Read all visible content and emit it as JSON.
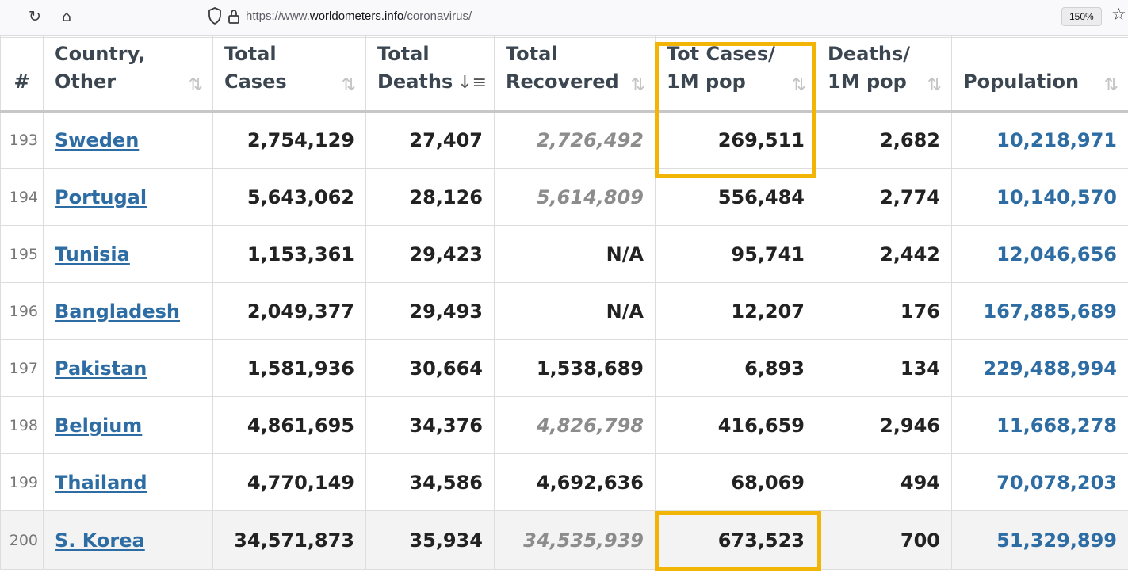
{
  "browser": {
    "url_prefix": "https://www.",
    "url_domain": "worldometers.info",
    "url_path": "/coronavirus/",
    "zoom": "150%",
    "icons": {
      "reload": "reload-icon",
      "home": "home-icon",
      "shield": "shield-icon",
      "lock": "lock-icon",
      "star": "star-icon"
    }
  },
  "table": {
    "columns": [
      {
        "label": "#"
      },
      {
        "label": "Country,\nOther"
      },
      {
        "label": "Total\nCases"
      },
      {
        "label": "Total\nDeaths"
      },
      {
        "label": "Total\nRecovered"
      },
      {
        "label": "Tot Cases/\n1M pop"
      },
      {
        "label": "Deaths/\n1M pop"
      },
      {
        "label": "Population"
      }
    ],
    "sorted_column": "Total Deaths",
    "rows": [
      {
        "rank": "193",
        "country": "Sweden",
        "total_cases": "2,754,129",
        "total_deaths": "27,407",
        "total_recovered": "2,726,492",
        "recovered_estimated": true,
        "cases_per_1m": "269,511",
        "deaths_per_1m": "2,682",
        "population": "10,218,971"
      },
      {
        "rank": "194",
        "country": "Portugal",
        "total_cases": "5,643,062",
        "total_deaths": "28,126",
        "total_recovered": "5,614,809",
        "recovered_estimated": true,
        "cases_per_1m": "556,484",
        "deaths_per_1m": "2,774",
        "population": "10,140,570"
      },
      {
        "rank": "195",
        "country": "Tunisia",
        "total_cases": "1,153,361",
        "total_deaths": "29,423",
        "total_recovered": "N/A",
        "recovered_estimated": false,
        "cases_per_1m": "95,741",
        "deaths_per_1m": "2,442",
        "population": "12,046,656"
      },
      {
        "rank": "196",
        "country": "Bangladesh",
        "total_cases": "2,049,377",
        "total_deaths": "29,493",
        "total_recovered": "N/A",
        "recovered_estimated": false,
        "cases_per_1m": "12,207",
        "deaths_per_1m": "176",
        "population": "167,885,689"
      },
      {
        "rank": "197",
        "country": "Pakistan",
        "total_cases": "1,581,936",
        "total_deaths": "30,664",
        "total_recovered": "1,538,689",
        "recovered_estimated": false,
        "cases_per_1m": "6,893",
        "deaths_per_1m": "134",
        "population": "229,488,994"
      },
      {
        "rank": "198",
        "country": "Belgium",
        "total_cases": "4,861,695",
        "total_deaths": "34,376",
        "total_recovered": "4,826,798",
        "recovered_estimated": true,
        "cases_per_1m": "416,659",
        "deaths_per_1m": "2,946",
        "population": "11,668,278"
      },
      {
        "rank": "199",
        "country": "Thailand",
        "total_cases": "4,770,149",
        "total_deaths": "34,586",
        "total_recovered": "4,692,636",
        "recovered_estimated": false,
        "cases_per_1m": "68,069",
        "deaths_per_1m": "494",
        "population": "70,078,203"
      },
      {
        "rank": "200",
        "country": "S. Korea",
        "total_cases": "34,571,873",
        "total_deaths": "35,934",
        "total_recovered": "34,535,939",
        "recovered_estimated": true,
        "cases_per_1m": "673,523",
        "deaths_per_1m": "700",
        "population": "51,329,899"
      }
    ]
  },
  "highlight_color": "#f3b505",
  "link_color": "#2e6da4"
}
